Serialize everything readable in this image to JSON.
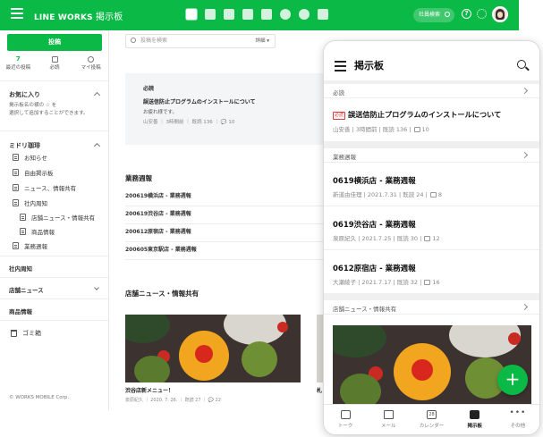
{
  "topbar": {
    "brand": "LINE WORKS",
    "service": "掲示板",
    "search_label": "社員検索",
    "help_icon_text": "?",
    "app_icons": [
      "board-icon",
      "chat-icon",
      "mail-icon",
      "calendar-icon",
      "address-book-icon",
      "drive-icon",
      "task-icon",
      "form-icon"
    ]
  },
  "sidebar": {
    "post_button": "投稿",
    "quick": [
      {
        "count": "7",
        "label": "最近の投稿"
      },
      {
        "label": "必読"
      },
      {
        "label": "マイ投稿"
      }
    ],
    "favorites_title": "お気に入り",
    "favorites_desc": "掲示板名の横の ☆ を\n選択して追加することができます。",
    "group_title": "ミドリ珈琲",
    "items": [
      "お知らせ",
      "自由掲示板",
      "ニュース、情報共有",
      "社内周知",
      "店舗ニュース・情報共有",
      "商品情報",
      "業務週報"
    ],
    "sections": [
      "社内周知",
      "店舗ニュース",
      "商品情報"
    ],
    "trash": "ゴミ箱",
    "copyright": "© WORKS MOBILE Corp."
  },
  "main": {
    "search_placeholder": "投稿を検索",
    "search_detail": "詳細 ▾",
    "notice": {
      "category": "必読",
      "title": "誤送信防止プログラムのインストールについて",
      "body": "お疲れ様です。",
      "meta": "山安善 ｜ 3時間前 ｜ 既読 136 ｜ 💬 10"
    },
    "weekly_title": "業務週報",
    "weekly_rows": [
      "200619横浜店 - 業務週報",
      "200619渋谷店 - 業務週報",
      "200612原宿店 - 業務週報",
      "200605東京駅店 - 業務週報"
    ],
    "store_title": "店舗ニュース・情報共有",
    "card": {
      "title": "渋谷店新メニュー！",
      "meta": "泉原紀久 ｜ 2020. 7. 26. ｜ 既読 27 ｜ 💬 22"
    },
    "card2_title": "札"
  },
  "phone": {
    "title": "掲示板",
    "section1": "必読",
    "notice": {
      "badge": "必読",
      "title": "誤送信防止プログラムのインストールについて",
      "meta": "山安善 | 3時間前 | 既読 136 |",
      "comments": "10"
    },
    "section2": "業務週報",
    "posts": [
      {
        "title": "0619横浜店 - 業務週報",
        "meta": "新道由佳理 | 2021.7.31 | 既読 24 |",
        "comments": "8"
      },
      {
        "title": "0619渋谷店 - 業務週報",
        "meta": "泉原紀久 | 2021.7.25 | 既読 30 |",
        "comments": "12"
      },
      {
        "title": "0612原宿店 - 業務週報",
        "meta": "大瀬綾子 | 2021.7.17 | 既読 32 |",
        "comments": "16"
      }
    ],
    "section3": "店舗ニュース・情報共有",
    "fab": "+",
    "tabs": [
      {
        "label": "トーク",
        "icon": "chat-icon"
      },
      {
        "label": "メール",
        "icon": "mail-icon"
      },
      {
        "label": "カレンダー",
        "icon": "calendar-icon",
        "icon_text": "28"
      },
      {
        "label": "掲示板",
        "icon": "board-icon",
        "active": true
      },
      {
        "label": "その他",
        "icon": "more-icon",
        "icon_text": "•••"
      }
    ]
  },
  "colors": {
    "brand": "#0ab946",
    "badge_red": "#e03a3a"
  }
}
